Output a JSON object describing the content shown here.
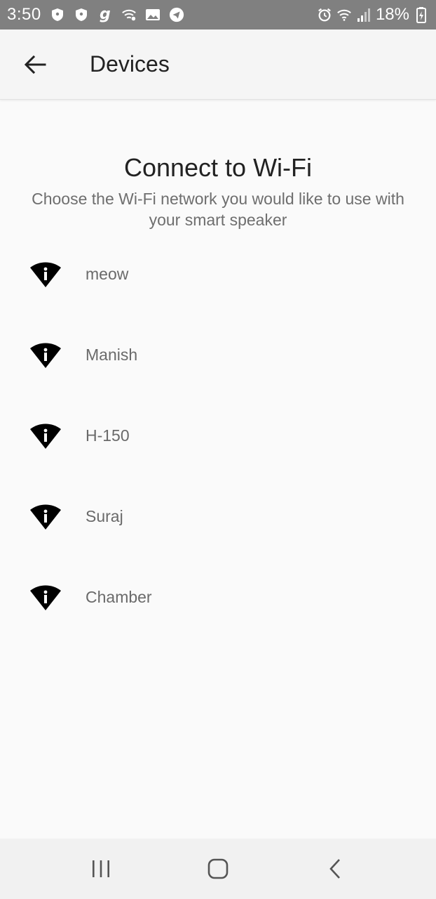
{
  "status_bar": {
    "time": "3:50",
    "battery": "18%",
    "icons_left": [
      "shield-icon",
      "shield-icon",
      "g-app-icon",
      "wifi-question-icon",
      "image-icon",
      "telegram-icon"
    ],
    "icons_right": [
      "alarm-icon",
      "wifi-signal-icon",
      "cell-signal-icon",
      "battery-icon"
    ]
  },
  "app_bar": {
    "title": "Devices",
    "back_icon": "arrow-left-icon"
  },
  "main": {
    "heading": "Connect to Wi-Fi",
    "subheading": "Choose the Wi-Fi network you would like to use with your smart speaker",
    "networks": [
      {
        "name": "meow",
        "icon": "wifi-info-icon"
      },
      {
        "name": "Manish",
        "icon": "wifi-info-icon"
      },
      {
        "name": "H-150",
        "icon": "wifi-info-icon"
      },
      {
        "name": "Suraj",
        "icon": "wifi-info-icon"
      },
      {
        "name": "Chamber",
        "icon": "wifi-info-icon"
      }
    ]
  },
  "nav_bar": {
    "buttons": [
      "recent-apps-icon",
      "home-icon",
      "back-icon"
    ]
  },
  "colors": {
    "status_bar_bg": "#808080",
    "app_bar_bg": "#f5f5f5",
    "page_bg": "#fafafa",
    "nav_bar_bg": "#f1f1f1",
    "heading_text": "#222222",
    "secondary_text": "#6a6a6a"
  }
}
